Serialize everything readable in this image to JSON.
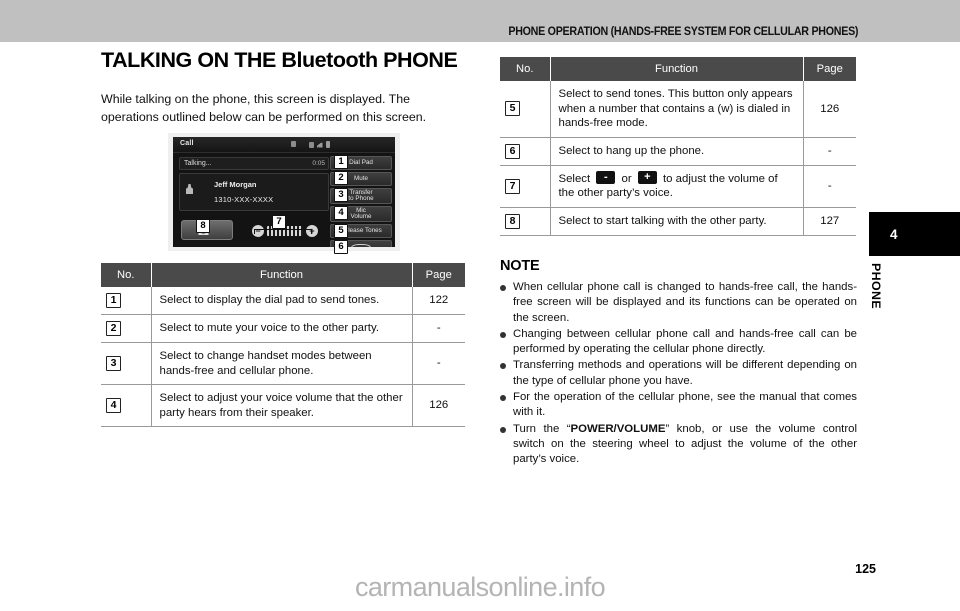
{
  "header": {
    "running_title": "PHONE OPERATION (HANDS-FREE SYSTEM FOR CELLULAR PHONES)"
  },
  "left_column": {
    "title": "TALKING ON THE Bluetooth PHONE",
    "intro_line1": "While talking on the phone, this screen is displayed. The",
    "intro_line2": "operations outlined below can be performed on this screen."
  },
  "screen_illustration": {
    "name": "bluetooth-talking-screen",
    "title_label": "Call",
    "status_label": "Talking...",
    "timer": "0:05",
    "contact_name": "Jeff Morgan",
    "contact_number": "1310-XXX-XXXX",
    "buttons": [
      {
        "callout": "1",
        "label": "Dial Pad"
      },
      {
        "callout": "2",
        "label": "Mute"
      },
      {
        "callout": "3",
        "label": "Transfer to Phone",
        "line1": "Transfer",
        "line2": "to Phone"
      },
      {
        "callout": "4",
        "label": "Mic Volume",
        "line1": "Mic",
        "line2": "Volume"
      },
      {
        "callout": "5",
        "label": "Release Tones"
      },
      {
        "callout": "6",
        "label": "hang-up"
      }
    ],
    "volume_callout": "7",
    "volume_minus": "−",
    "volume_plus": "+",
    "answer_callout": "8"
  },
  "table_headers": {
    "no": "No.",
    "function": "Function",
    "page": "Page"
  },
  "left_table": {
    "rows": [
      {
        "no": "1",
        "function": "Select to display the dial pad to send tones.",
        "page": "122"
      },
      {
        "no": "2",
        "function": "Select to mute your voice to the other party.",
        "page": "-"
      },
      {
        "no": "3",
        "function": "Select to change handset modes between hands-free and cellular phone.",
        "page": "-"
      },
      {
        "no": "4",
        "function": "Select to adjust your voice volume that the other party hears from their speaker.",
        "page": "126"
      }
    ]
  },
  "right_table": {
    "rows": [
      {
        "no": "5",
        "function": "Select to send tones. This button only appears when a number that contains a (w) is dialed in hands-free mode.",
        "page": "126"
      },
      {
        "no": "6",
        "function": "Select to hang up the phone.",
        "page": "-"
      },
      {
        "no": "7",
        "function_pre": "Select",
        "key_minus": "-",
        "function_mid": "or",
        "key_plus": "+",
        "function_post": "to adjust the volume of the other party’s voice.",
        "page": "-"
      },
      {
        "no": "8",
        "function": "Select to start talking with the other party.",
        "page": "127"
      }
    ]
  },
  "note": {
    "title": "NOTE",
    "items": [
      "When cellular phone call is changed to hands-free call, the hands-free screen will be displayed and its functions can be operated on the screen.",
      "Changing between cellular phone call and hands-free call can be performed by operating the cellular phone directly.",
      "Transferring methods and operations will be different depending on the type of cellular phone you have.",
      "For the operation of the cellular phone, see the manual that comes with it."
    ],
    "last_item": {
      "pre": "Turn the “",
      "bold": "POWER/VOLUME",
      "post": "” knob, or use the volume control switch on the steering wheel to adjust the volume of the other party’s voice."
    }
  },
  "chapter": {
    "number": "4",
    "name": "PHONE"
  },
  "footer": {
    "page_number": "125",
    "watermark": "carmanualsonline.info"
  }
}
